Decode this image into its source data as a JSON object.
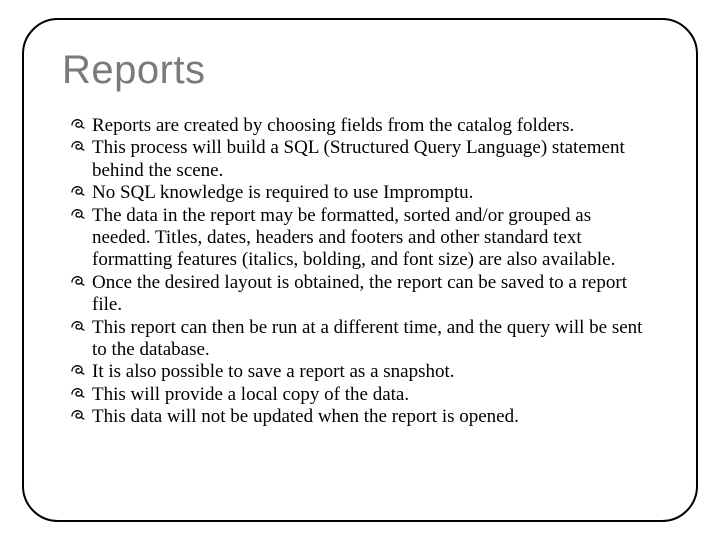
{
  "title": "Reports",
  "bullets": [
    "Reports are created by choosing fields from the catalog folders.",
    "This process will build a SQL (Structured Query Language) statement behind the scene.",
    "No SQL knowledge is required to use Impromptu.",
    "The data in the report may be formatted, sorted and/or grouped as needed. Titles, dates, headers and footers and other standard text formatting features (italics, bolding, and font size) are also available.",
    "Once the desired layout is obtained, the report can be saved to a report file.",
    "This report can then be run at a different time, and the query will be sent to the database.",
    "It is also possible to save a report as a snapshot.",
    "This will provide a local copy of the data.",
    "This data will not be updated when the report is opened."
  ]
}
